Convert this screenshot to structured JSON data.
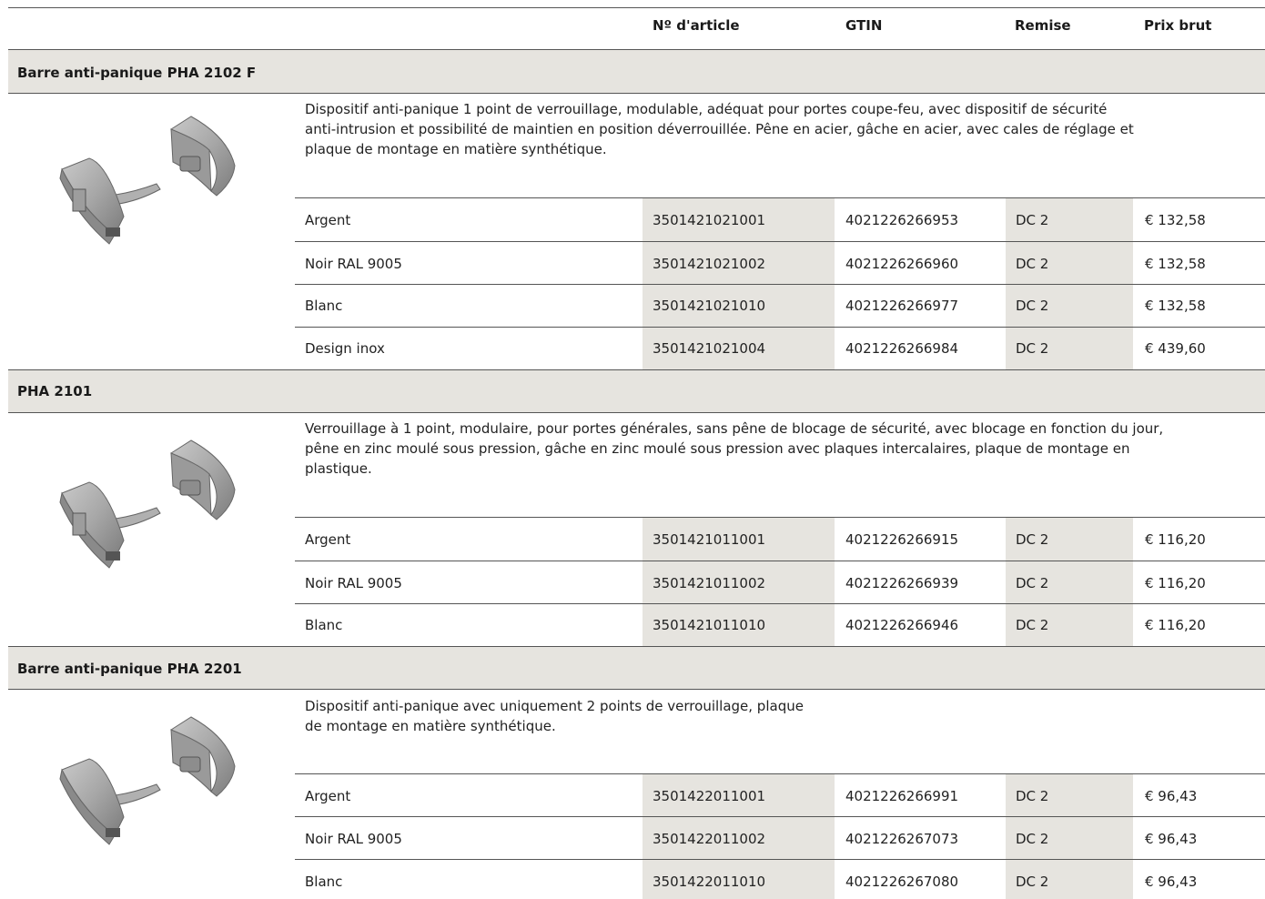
{
  "headers": {
    "article": "Nº d'article",
    "gtin": "GTIN",
    "discount": "Remise",
    "price": "Prix brut"
  },
  "groups": [
    {
      "title": "Barre anti-panique PHA 2102 F",
      "description": [
        "Dispositif anti-panique 1 point de verrouillage, modulable, adéquat pour portes coupe-feu, avec dispositif de sécurité",
        "anti-intrusion et possibilité de maintien en position déverrouillée. Pêne en acier, gâche en acier, avec cales de réglage et",
        "plaque de montage en matière synthétique."
      ],
      "rows": [
        {
          "variant": "Argent",
          "article": "3501421021001",
          "gtin": "4021226266953",
          "discount": "DC 2",
          "price": "€ 132,58"
        },
        {
          "variant": "Noir RAL 9005",
          "article": "3501421021002",
          "gtin": "4021226266960",
          "discount": "DC 2",
          "price": "€ 132,58"
        },
        {
          "variant": "Blanc",
          "article": "3501421021010",
          "gtin": "4021226266977",
          "discount": "DC 2",
          "price": "€ 132,58"
        },
        {
          "variant": "Design inox",
          "article": "3501421021004",
          "gtin": "4021226266984",
          "discount": "DC 2",
          "price": "€ 439,60"
        }
      ]
    },
    {
      "title": "PHA 2101",
      "description": [
        "Verrouillage à 1 point, modulaire, pour portes générales, sans pêne de blocage de sécurité, avec blocage en fonction du jour,",
        "pêne en zinc moulé sous pression, gâche en zinc moulé sous pression avec plaques intercalaires, plaque de montage en",
        "plastique."
      ],
      "rows": [
        {
          "variant": "Argent",
          "article": "3501421011001",
          "gtin": "4021226266915",
          "discount": "DC 2",
          "price": "€ 116,20"
        },
        {
          "variant": "Noir RAL 9005",
          "article": "3501421011002",
          "gtin": "4021226266939",
          "discount": "DC 2",
          "price": "€ 116,20"
        },
        {
          "variant": "Blanc",
          "article": "3501421011010",
          "gtin": "4021226266946",
          "discount": "DC 2",
          "price": "€ 116,20"
        }
      ]
    },
    {
      "title": "Barre anti-panique PHA 2201",
      "description": [
        "Dispositif anti-panique avec uniquement 2 points de verrouillage, plaque",
        "de montage en matière synthétique."
      ],
      "rows": [
        {
          "variant": "Argent",
          "article": "3501422011001",
          "gtin": "4021226266991",
          "discount": "DC 2",
          "price": "€ 96,43"
        },
        {
          "variant": "Noir RAL 9005",
          "article": "3501422011002",
          "gtin": "4021226267073",
          "discount": "DC 2",
          "price": "€ 96,43"
        },
        {
          "variant": "Blanc",
          "article": "3501422011010",
          "gtin": "4021226267080",
          "discount": "DC 2",
          "price": "€ 96,43"
        }
      ]
    }
  ],
  "colors": {
    "shade": "#e6e4df",
    "rule": "#555555"
  },
  "icons": {
    "product": "panic-bar-product-icon"
  }
}
